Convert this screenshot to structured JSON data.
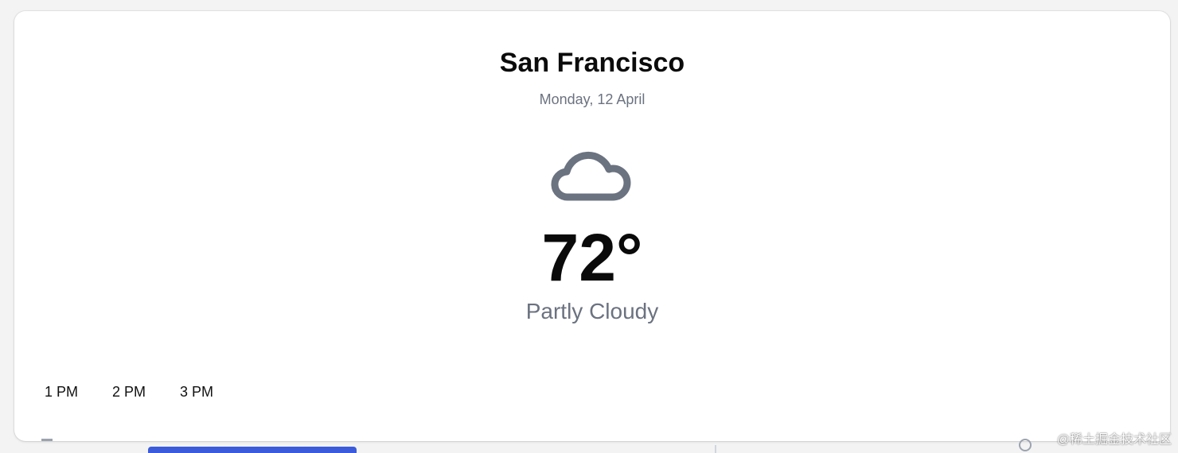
{
  "location": {
    "city": "San Francisco",
    "date": "Monday, 12 April"
  },
  "current": {
    "icon": "cloud-icon",
    "temperature": "72°",
    "condition": "Partly Cloudy"
  },
  "hourly": [
    {
      "time": "1 PM"
    },
    {
      "time": "2 PM"
    },
    {
      "time": "3 PM"
    }
  ],
  "watermark": "@稀土掘金技术社区",
  "colors": {
    "background": "#f3f3f4",
    "card": "#ffffff",
    "primary_text": "#0b0b0c",
    "muted_text": "#6b7280",
    "icon_stroke": "#6b7280",
    "accent": "#3b5bdb"
  }
}
